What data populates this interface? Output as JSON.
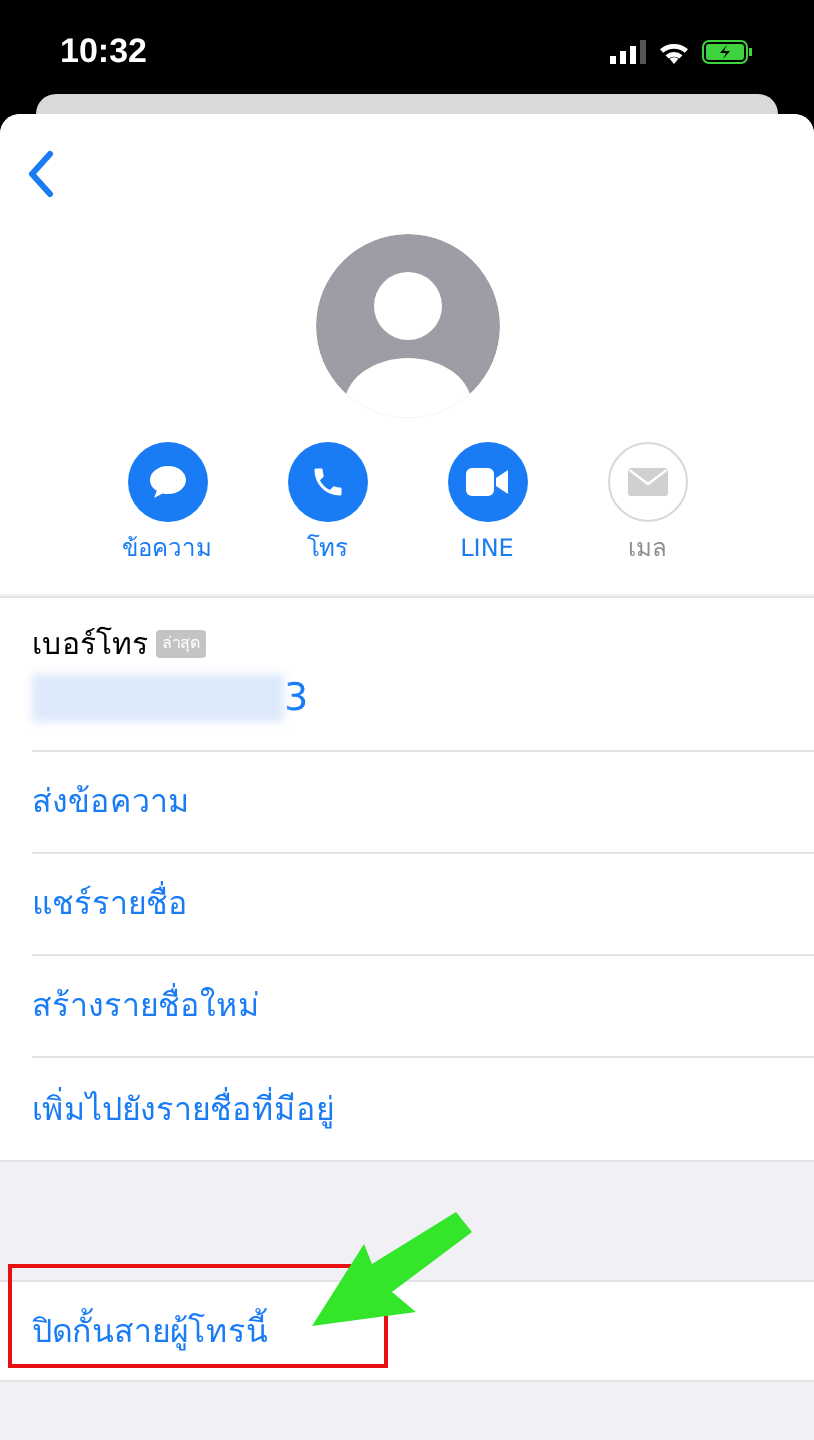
{
  "status_bar": {
    "time": "10:32"
  },
  "actions": [
    {
      "kind": "message",
      "label": "ข้อความ",
      "disabled": false
    },
    {
      "kind": "call",
      "label": "โทร",
      "disabled": false
    },
    {
      "kind": "video",
      "label": "LINE",
      "disabled": false
    },
    {
      "kind": "mail",
      "label": "เมล",
      "disabled": true
    }
  ],
  "phone": {
    "label": "เบอร์โทร",
    "badge": "ล่าสุด",
    "number": "3"
  },
  "rows": [
    {
      "label": "ส่งข้อความ"
    },
    {
      "label": "แชร์รายชื่อ"
    },
    {
      "label": "สร้างรายชื่อใหม่"
    },
    {
      "label": "เพิ่มไปยังรายชื่อที่มีอยู่"
    }
  ],
  "block_row": {
    "label": "ปิดกั้นสายผู้โทรนี้",
    "highlighted": true
  }
}
